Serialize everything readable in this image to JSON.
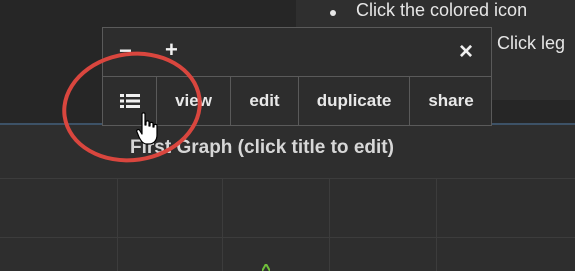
{
  "help": {
    "line1": "Click the colored icon",
    "line2": "Click leg"
  },
  "toolbar": {
    "minus_glyph": "−",
    "plus_glyph": "+",
    "close_glyph": "×",
    "list_icon": "list-icon",
    "buttons": [
      "view",
      "edit",
      "duplicate",
      "share"
    ]
  },
  "graph": {
    "title": "First Graph (click title to edit)"
  },
  "colors": {
    "annotation_circle": "#d9463e",
    "divider": "#3d5267",
    "series_mark": "#6fbf3a"
  }
}
